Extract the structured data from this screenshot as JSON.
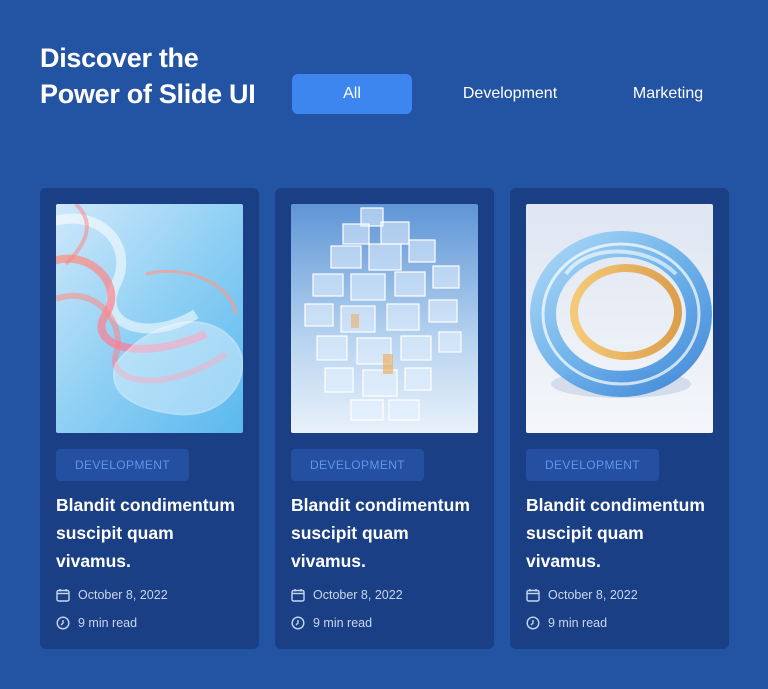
{
  "page": {
    "title": "Discover the Power of Slide UI"
  },
  "filters": [
    {
      "label": "All",
      "active": true
    },
    {
      "label": "Development",
      "active": false
    },
    {
      "label": "Marketing",
      "active": false
    }
  ],
  "cards": [
    {
      "badge": "DEVELOPMENT",
      "title": "Blandit condimentum suscipit quam vivamus.",
      "date": "October 8, 2022",
      "read_time": "9 min read",
      "image": "glass-waves-image"
    },
    {
      "badge": "DEVELOPMENT",
      "title": "Blandit condimentum suscipit quam vivamus.",
      "date": "October 8, 2022",
      "read_time": "9 min read",
      "image": "glass-cubes-image"
    },
    {
      "badge": "DEVELOPMENT",
      "title": "Blandit condimentum suscipit quam vivamus.",
      "date": "October 8, 2022",
      "read_time": "9 min read",
      "image": "glass-ring-image"
    }
  ],
  "colors": {
    "background": "#2354a3",
    "card": "#1a3f85",
    "accent": "#3d86f0",
    "badge_text": "#5f97ec"
  },
  "icons": {
    "date": "calendar-icon",
    "read": "clock-icon"
  }
}
